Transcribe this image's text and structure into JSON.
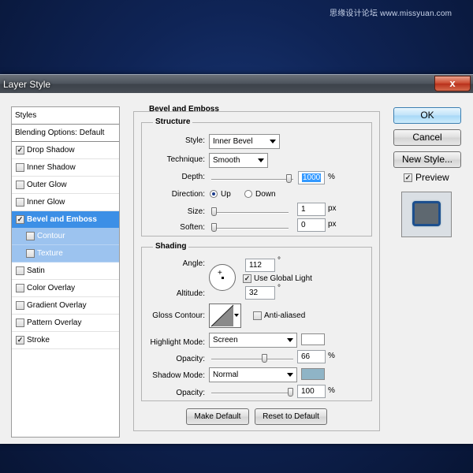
{
  "watermark": "思缘设计论坛 www.missyuan.com",
  "window": {
    "title": "Layer Style",
    "close_glyph": "x"
  },
  "styles_panel": {
    "header": "Styles",
    "blending": "Blending Options: Default",
    "items": [
      {
        "label": "Drop Shadow",
        "checked": true
      },
      {
        "label": "Inner Shadow",
        "checked": false
      },
      {
        "label": "Outer Glow",
        "checked": false
      },
      {
        "label": "Inner Glow",
        "checked": false
      },
      {
        "label": "Bevel and Emboss",
        "checked": true,
        "selected": true
      },
      {
        "label": "Contour",
        "checked": false,
        "sub": true
      },
      {
        "label": "Texture",
        "checked": false,
        "sub": true
      },
      {
        "label": "Satin",
        "checked": false
      },
      {
        "label": "Color Overlay",
        "checked": false
      },
      {
        "label": "Gradient Overlay",
        "checked": false
      },
      {
        "label": "Pattern Overlay",
        "checked": false
      },
      {
        "label": "Stroke",
        "checked": true
      }
    ]
  },
  "bevel": {
    "title": "Bevel and Emboss",
    "structure": {
      "title": "Structure",
      "style_label": "Style:",
      "style_value": "Inner Bevel",
      "technique_label": "Technique:",
      "technique_value": "Smooth",
      "depth_label": "Depth:",
      "depth_value": "1000",
      "depth_unit": "%",
      "depth_level": 0.98,
      "direction_label": "Direction:",
      "dir_up": "Up",
      "dir_down": "Down",
      "direction_selected": "Up",
      "size_label": "Size:",
      "size_value": "1",
      "size_unit": "px",
      "size_level": 0.0,
      "soften_label": "Soften:",
      "soften_value": "0",
      "soften_unit": "px",
      "soften_level": 0.0
    },
    "shading": {
      "title": "Shading",
      "angle_label": "Angle:",
      "angle_value": "112",
      "angle_unit": "°",
      "global_light_label": "Use Global Light",
      "global_light_checked": true,
      "altitude_label": "Altitude:",
      "altitude_value": "32",
      "altitude_unit": "°",
      "gloss_label": "Gloss Contour:",
      "antialiased_label": "Anti-aliased",
      "antialiased_checked": false,
      "highlight_label": "Highlight Mode:",
      "highlight_value": "Screen",
      "highlight_color": "#ffffff",
      "highlight_opacity_label": "Opacity:",
      "highlight_opacity_value": "66",
      "highlight_opacity_unit": "%",
      "highlight_opacity_level": 0.66,
      "shadow_label": "Shadow Mode:",
      "shadow_value": "Normal",
      "shadow_color": "#8fb4c6",
      "shadow_opacity_label": "Opacity:",
      "shadow_opacity_value": "100",
      "shadow_opacity_unit": "%",
      "shadow_opacity_level": 1.0
    },
    "make_default": "Make Default",
    "reset_default": "Reset to Default"
  },
  "buttons": {
    "ok": "OK",
    "cancel": "Cancel",
    "new_style": "New Style...",
    "preview_label": "Preview",
    "preview_checked": true
  }
}
